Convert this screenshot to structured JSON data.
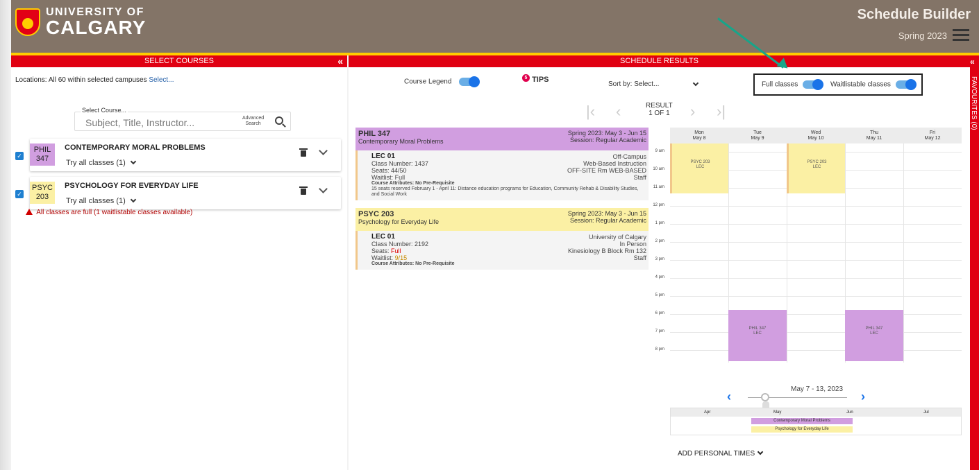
{
  "header": {
    "logo_line1": "UNIVERSITY OF",
    "logo_line2": "CALGARY",
    "app_title": "Schedule Builder",
    "term": "Spring 2023"
  },
  "bars": {
    "left": "SELECT COURSES",
    "right": "SCHEDULE RESULTS",
    "collapse": "«",
    "favourites": "FAVOURITES (0)"
  },
  "left": {
    "locations_label": "Locations:",
    "locations_text": "All 60 within selected campuses",
    "locations_link": "Select...",
    "search_legend": "Select Course...",
    "search_placeholder": "Subject, Title, Instructor...",
    "advanced_1": "Advanced",
    "advanced_2": "Search",
    "courses": [
      {
        "code1": "PHIL",
        "code2": "347",
        "title": "CONTEMPORARY MORAL PROBLEMS",
        "try": "Try all classes (1)",
        "color": "#d19ee0"
      },
      {
        "code1": "PSYC",
        "code2": "203",
        "title": "PSYCHOLOGY FOR EVERYDAY LIFE",
        "try": "Try all classes (1)",
        "color": "#fbf0a4"
      }
    ],
    "warning": "All classes are full (1 waitlistable classes available)"
  },
  "right": {
    "course_legend": "Course Legend",
    "tips_count": "5",
    "tips": "TIPS",
    "sort_label": "Sort by:",
    "sort_value": "Select...",
    "full_classes": "Full classes",
    "waitlistable": "Waitlistable classes",
    "result_1": "RESULT",
    "result_2": "1 OF 1",
    "sections": [
      {
        "code": "PHIL 347",
        "name": "Contemporary Moral Problems",
        "term_line": "Spring 2023: May 3 - Jun 15",
        "session": "Session: Regular Academic",
        "lec": "LEC 01",
        "class_number": "Class Number: 1437",
        "seats": "Seats: 44/50",
        "waitlist": "Waitlist: Full",
        "attributes": "Course Attributes: No Pre-Requisite",
        "note": "15 seats reserved February 1 - April 11: Distance education programs for Education, Community Rehab & Disability Studies, and Social Work",
        "loc1": "Off-Campus",
        "loc2": "Web-Based Instruction",
        "loc3": "OFF-SITE Rm WEB-BASED",
        "loc4": "Staff"
      },
      {
        "code": "PSYC 203",
        "name": "Psychology for Everyday Life",
        "term_line": "Spring 2023: May 3 - Jun 15",
        "session": "Session: Regular Academic",
        "lec": "LEC 01",
        "class_number": "Class Number: 2192",
        "seats_label": "Seats: ",
        "seats_value": "Full",
        "waitlist_label": "Waitlist: ",
        "waitlist_value": "9/15",
        "attributes": "Course Attributes: No Pre-Requisite",
        "loc1": "University of Calgary",
        "loc2": "In Person",
        "loc3": "Kinesiology B Block Rm 132",
        "loc4": "Staff"
      }
    ],
    "calendar": {
      "days": [
        {
          "d": "Mon",
          "date": "May 8"
        },
        {
          "d": "Tue",
          "date": "May 9"
        },
        {
          "d": "Wed",
          "date": "May 10"
        },
        {
          "d": "Thu",
          "date": "May 11"
        },
        {
          "d": "Fri",
          "date": "May 12"
        }
      ],
      "hours": [
        "9 am",
        "10 am",
        "11 am",
        "12 pm",
        "1 pm",
        "2 pm",
        "3 pm",
        "4 pm",
        "5 pm",
        "6 pm",
        "7 pm",
        "8 pm"
      ],
      "events": [
        {
          "code": "PSYC 203",
          "type": "LEC"
        },
        {
          "code": "PSYC 203",
          "type": "LEC"
        },
        {
          "code": "PHIL 347",
          "type": "LEC"
        },
        {
          "code": "PHIL 347",
          "type": "LEC"
        }
      ]
    },
    "range_text": "May 7 - 13, 2023",
    "timeline": {
      "months": [
        "Apr",
        "May",
        "Jun",
        "Jul"
      ],
      "bar1": "Contemporary Moral Problems",
      "bar2": "Psychology for Everyday Life"
    },
    "add_personal": "ADD PERSONAL TIMES"
  },
  "colors": {
    "brand_red": "#e00012",
    "gold": "#ffcd00",
    "header": "#837467",
    "phil": "#d19ee0",
    "psyc": "#fbf0a4",
    "toggle": "#1a73e8",
    "annotation_arrow": "#17a58a"
  }
}
